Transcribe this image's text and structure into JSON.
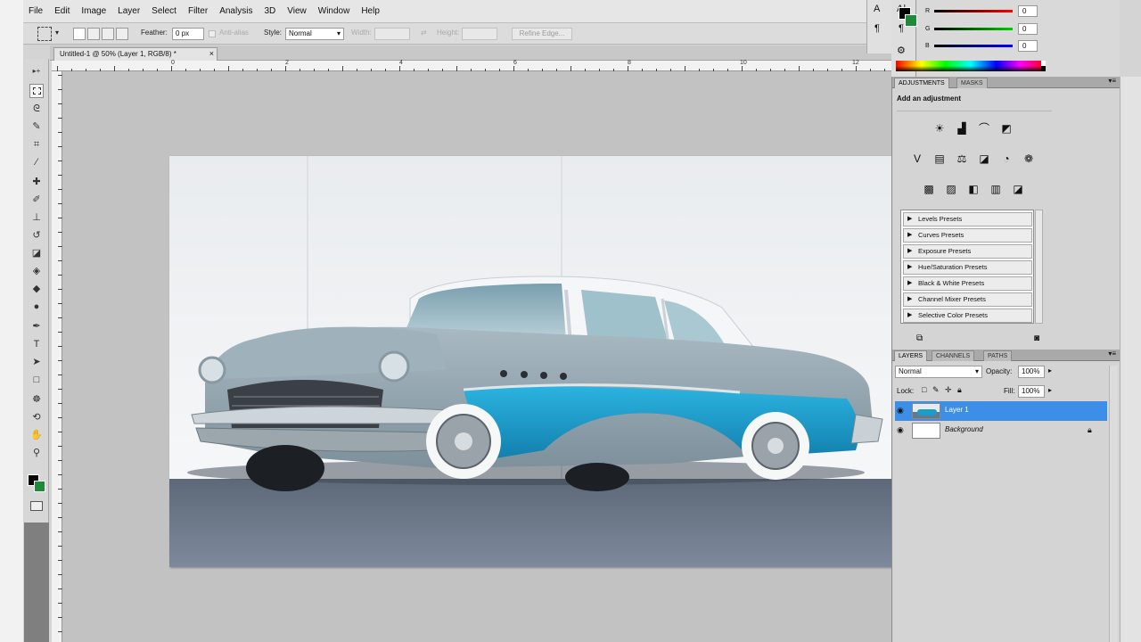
{
  "app": {
    "menu": [
      "File",
      "Edit",
      "Image",
      "Layer",
      "Select",
      "Filter",
      "Analysis",
      "3D",
      "View",
      "Window",
      "Help"
    ]
  },
  "options": {
    "feather_label": "Feather:",
    "feather_value": "0 px",
    "anti_alias": "Anti-alias",
    "style_label": "Style:",
    "style_value": "Normal",
    "width_label": "Width:",
    "height_label": "Height:",
    "refine_edge": "Refine Edge..."
  },
  "document": {
    "tab_title": "Untitled-1 @ 50% (Layer 1, RGB/8) *",
    "close": "×"
  },
  "ruler": {
    "marks": [
      "0",
      "2",
      "4",
      "6",
      "8",
      "10",
      "12"
    ]
  },
  "color_panel": {
    "r_label": "R",
    "g_label": "G",
    "b_label": "B",
    "r_value": "0",
    "g_value": "0",
    "b_value": "0",
    "foreground": "#000000",
    "background": "#1f8a3a"
  },
  "adjustments": {
    "tabs": [
      "ADJUSTMENTS",
      "MASKS"
    ],
    "heading": "Add an adjustment",
    "presets": [
      "Levels Presets",
      "Curves Presets",
      "Exposure Presets",
      "Hue/Saturation Presets",
      "Black & White Presets",
      "Channel Mixer Presets",
      "Selective Color Presets"
    ]
  },
  "layers": {
    "tabs": [
      "LAYERS",
      "CHANNELS",
      "PATHS"
    ],
    "blend_mode": "Normal",
    "opacity_label": "Opacity:",
    "opacity_value": "100%",
    "lock_label": "Lock:",
    "fill_label": "Fill:",
    "fill_value": "100%",
    "items": [
      {
        "name": "Layer 1",
        "selected": true
      },
      {
        "name": "Background",
        "selected": false,
        "locked": true
      }
    ]
  },
  "colors": {
    "selection_blue": "#3d8ee6",
    "car_teal": "#1a9dc9",
    "car_grey": "#8fa3ad"
  }
}
